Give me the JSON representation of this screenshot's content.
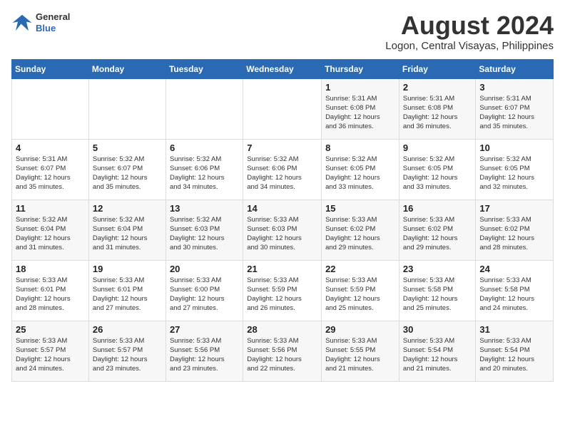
{
  "header": {
    "logo_general": "General",
    "logo_blue": "Blue",
    "title": "August 2024",
    "subtitle": "Logon, Central Visayas, Philippines"
  },
  "weekdays": [
    "Sunday",
    "Monday",
    "Tuesday",
    "Wednesday",
    "Thursday",
    "Friday",
    "Saturday"
  ],
  "weeks": [
    [
      {
        "day": "",
        "info": ""
      },
      {
        "day": "",
        "info": ""
      },
      {
        "day": "",
        "info": ""
      },
      {
        "day": "",
        "info": ""
      },
      {
        "day": "1",
        "info": "Sunrise: 5:31 AM\nSunset: 6:08 PM\nDaylight: 12 hours\nand 36 minutes."
      },
      {
        "day": "2",
        "info": "Sunrise: 5:31 AM\nSunset: 6:08 PM\nDaylight: 12 hours\nand 36 minutes."
      },
      {
        "day": "3",
        "info": "Sunrise: 5:31 AM\nSunset: 6:07 PM\nDaylight: 12 hours\nand 35 minutes."
      }
    ],
    [
      {
        "day": "4",
        "info": "Sunrise: 5:31 AM\nSunset: 6:07 PM\nDaylight: 12 hours\nand 35 minutes."
      },
      {
        "day": "5",
        "info": "Sunrise: 5:32 AM\nSunset: 6:07 PM\nDaylight: 12 hours\nand 35 minutes."
      },
      {
        "day": "6",
        "info": "Sunrise: 5:32 AM\nSunset: 6:06 PM\nDaylight: 12 hours\nand 34 minutes."
      },
      {
        "day": "7",
        "info": "Sunrise: 5:32 AM\nSunset: 6:06 PM\nDaylight: 12 hours\nand 34 minutes."
      },
      {
        "day": "8",
        "info": "Sunrise: 5:32 AM\nSunset: 6:05 PM\nDaylight: 12 hours\nand 33 minutes."
      },
      {
        "day": "9",
        "info": "Sunrise: 5:32 AM\nSunset: 6:05 PM\nDaylight: 12 hours\nand 33 minutes."
      },
      {
        "day": "10",
        "info": "Sunrise: 5:32 AM\nSunset: 6:05 PM\nDaylight: 12 hours\nand 32 minutes."
      }
    ],
    [
      {
        "day": "11",
        "info": "Sunrise: 5:32 AM\nSunset: 6:04 PM\nDaylight: 12 hours\nand 31 minutes."
      },
      {
        "day": "12",
        "info": "Sunrise: 5:32 AM\nSunset: 6:04 PM\nDaylight: 12 hours\nand 31 minutes."
      },
      {
        "day": "13",
        "info": "Sunrise: 5:32 AM\nSunset: 6:03 PM\nDaylight: 12 hours\nand 30 minutes."
      },
      {
        "day": "14",
        "info": "Sunrise: 5:33 AM\nSunset: 6:03 PM\nDaylight: 12 hours\nand 30 minutes."
      },
      {
        "day": "15",
        "info": "Sunrise: 5:33 AM\nSunset: 6:02 PM\nDaylight: 12 hours\nand 29 minutes."
      },
      {
        "day": "16",
        "info": "Sunrise: 5:33 AM\nSunset: 6:02 PM\nDaylight: 12 hours\nand 29 minutes."
      },
      {
        "day": "17",
        "info": "Sunrise: 5:33 AM\nSunset: 6:02 PM\nDaylight: 12 hours\nand 28 minutes."
      }
    ],
    [
      {
        "day": "18",
        "info": "Sunrise: 5:33 AM\nSunset: 6:01 PM\nDaylight: 12 hours\nand 28 minutes."
      },
      {
        "day": "19",
        "info": "Sunrise: 5:33 AM\nSunset: 6:01 PM\nDaylight: 12 hours\nand 27 minutes."
      },
      {
        "day": "20",
        "info": "Sunrise: 5:33 AM\nSunset: 6:00 PM\nDaylight: 12 hours\nand 27 minutes."
      },
      {
        "day": "21",
        "info": "Sunrise: 5:33 AM\nSunset: 5:59 PM\nDaylight: 12 hours\nand 26 minutes."
      },
      {
        "day": "22",
        "info": "Sunrise: 5:33 AM\nSunset: 5:59 PM\nDaylight: 12 hours\nand 25 minutes."
      },
      {
        "day": "23",
        "info": "Sunrise: 5:33 AM\nSunset: 5:58 PM\nDaylight: 12 hours\nand 25 minutes."
      },
      {
        "day": "24",
        "info": "Sunrise: 5:33 AM\nSunset: 5:58 PM\nDaylight: 12 hours\nand 24 minutes."
      }
    ],
    [
      {
        "day": "25",
        "info": "Sunrise: 5:33 AM\nSunset: 5:57 PM\nDaylight: 12 hours\nand 24 minutes."
      },
      {
        "day": "26",
        "info": "Sunrise: 5:33 AM\nSunset: 5:57 PM\nDaylight: 12 hours\nand 23 minutes."
      },
      {
        "day": "27",
        "info": "Sunrise: 5:33 AM\nSunset: 5:56 PM\nDaylight: 12 hours\nand 23 minutes."
      },
      {
        "day": "28",
        "info": "Sunrise: 5:33 AM\nSunset: 5:56 PM\nDaylight: 12 hours\nand 22 minutes."
      },
      {
        "day": "29",
        "info": "Sunrise: 5:33 AM\nSunset: 5:55 PM\nDaylight: 12 hours\nand 21 minutes."
      },
      {
        "day": "30",
        "info": "Sunrise: 5:33 AM\nSunset: 5:54 PM\nDaylight: 12 hours\nand 21 minutes."
      },
      {
        "day": "31",
        "info": "Sunrise: 5:33 AM\nSunset: 5:54 PM\nDaylight: 12 hours\nand 20 minutes."
      }
    ]
  ]
}
